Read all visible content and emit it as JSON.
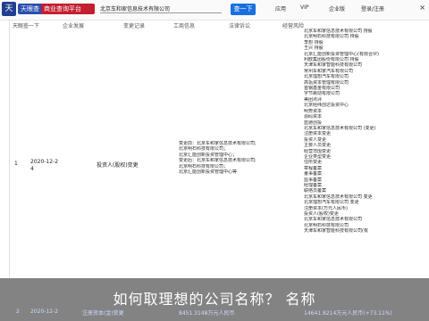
{
  "header": {
    "logo_glyph": "天",
    "brand_primary": "天眼查",
    "brand_secondary": "商业查询平台",
    "search_query": "北京车和家信息技术有限公司",
    "search_button": "查一下",
    "nav": [
      "应用",
      "VIP",
      "企业版",
      "登录/注册"
    ],
    "close_glyph": "×",
    "tags": [
      "天眼查一下",
      "企业发展",
      "变更记录",
      "工商信息",
      "法律诉讼",
      "经营风险"
    ]
  },
  "table": {
    "row_index": "1",
    "row_date": "2020-12-2\n4",
    "row_item": "投资人(股权)变更"
  },
  "mid_block": [
    "变更前：北京车和家信息技术有限公司;",
    "北京明石科技有限公司；",
    "北京汇能创新投资管理中心；",
    "变更后：北京车和家信息技术有限公司;",
    "北京明石科技有限公司；",
    "北京汇能创新投资管理中心等"
  ],
  "history": [
    "北京车和家信息技术有限公司 持股",
    "北京明石科技有限公司 持股",
    "李想 持股",
    "王兴 持股",
    "北京汇能创新投资管理中心(有限合伙)",
    "利欧集团股份有限公司 持股",
    "天津车和家智能科技有限公司",
    "常州车和家汽车有限公司",
    "北京理想汽车有限公司",
    "高瓴资本管理有限公司",
    "首钢基金有限公司",
    "字节跳动有限公司",
    "美团点评",
    "北京经纬创达投资中心",
    "明势资本",
    "源码资本",
    "蓝驰创投",
    "北京车和家信息技术有限公司 (变更)",
    "注册资本变更",
    "投资人变更",
    "主要人员变更",
    "经营范围变更",
    "企业类型变更",
    "住所变更",
    "章程备案",
    "董事备案",
    "监事备案",
    "经理备案",
    "联络员备案",
    "北京车和家信息技术有限公司 变更",
    "北京理想汽车有限公司 变更",
    "注册资本(万元人民币)",
    "投资人(股权)变更",
    "北京车和家信息技术有限公司",
    "北京明石科技有限公司",
    "天津车和家智能科技有限公司(有"
  ],
  "caption": "如何取理想的公司名称？ 名称",
  "bottom_row": {
    "index": "2",
    "date": "2020-12-2",
    "item": "注册资本(金)变更",
    "before": "8451.3148万元人民币",
    "after": "14641.8214万元人民币(+73.11%)"
  }
}
